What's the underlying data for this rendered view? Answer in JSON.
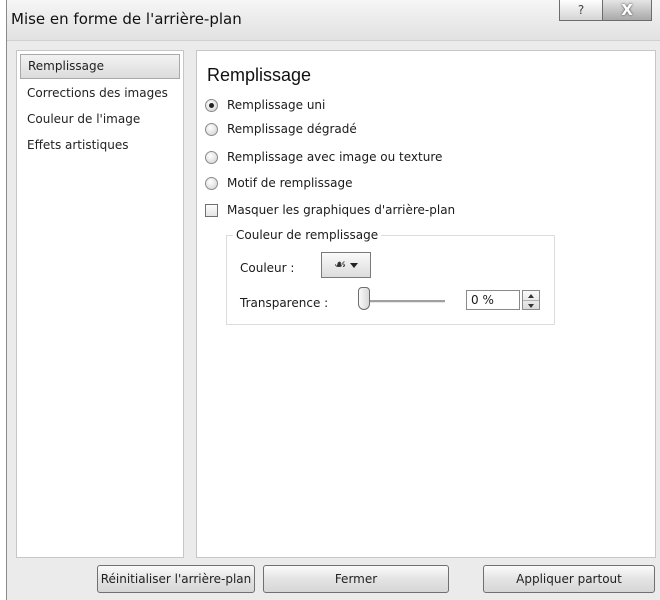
{
  "window": {
    "title": "Mise en forme de l'arrière-plan",
    "help_label": "?",
    "close_label": "X"
  },
  "sidebar": {
    "items": [
      {
        "label": "Remplissage",
        "selected": true
      },
      {
        "label": "Corrections des images",
        "selected": false
      },
      {
        "label": "Couleur de l'image",
        "selected": false
      },
      {
        "label": "Effets artistiques",
        "selected": false
      }
    ]
  },
  "panel": {
    "title": "Remplissage",
    "options": [
      {
        "label": "Remplissage uni",
        "checked": true
      },
      {
        "label": "Remplissage dégradé",
        "checked": false
      },
      {
        "label": "Remplissage avec image ou texture",
        "checked": false
      },
      {
        "label": "Motif de remplissage",
        "checked": false
      }
    ],
    "hide_background_graphics": {
      "label": "Masquer les graphiques d'arrière-plan",
      "checked": false
    },
    "fill_color_group": {
      "title": "Couleur de remplissage",
      "color_label": "Couleur :",
      "color_icon": "paint-bucket-icon",
      "transparency_label": "Transparence :",
      "transparency_value": "0 %",
      "transparency_fraction": 0
    }
  },
  "footer": {
    "reset_label": "Réinitialiser l'arrière-plan",
    "close_label": "Fermer",
    "apply_all_label": "Appliquer partout"
  }
}
